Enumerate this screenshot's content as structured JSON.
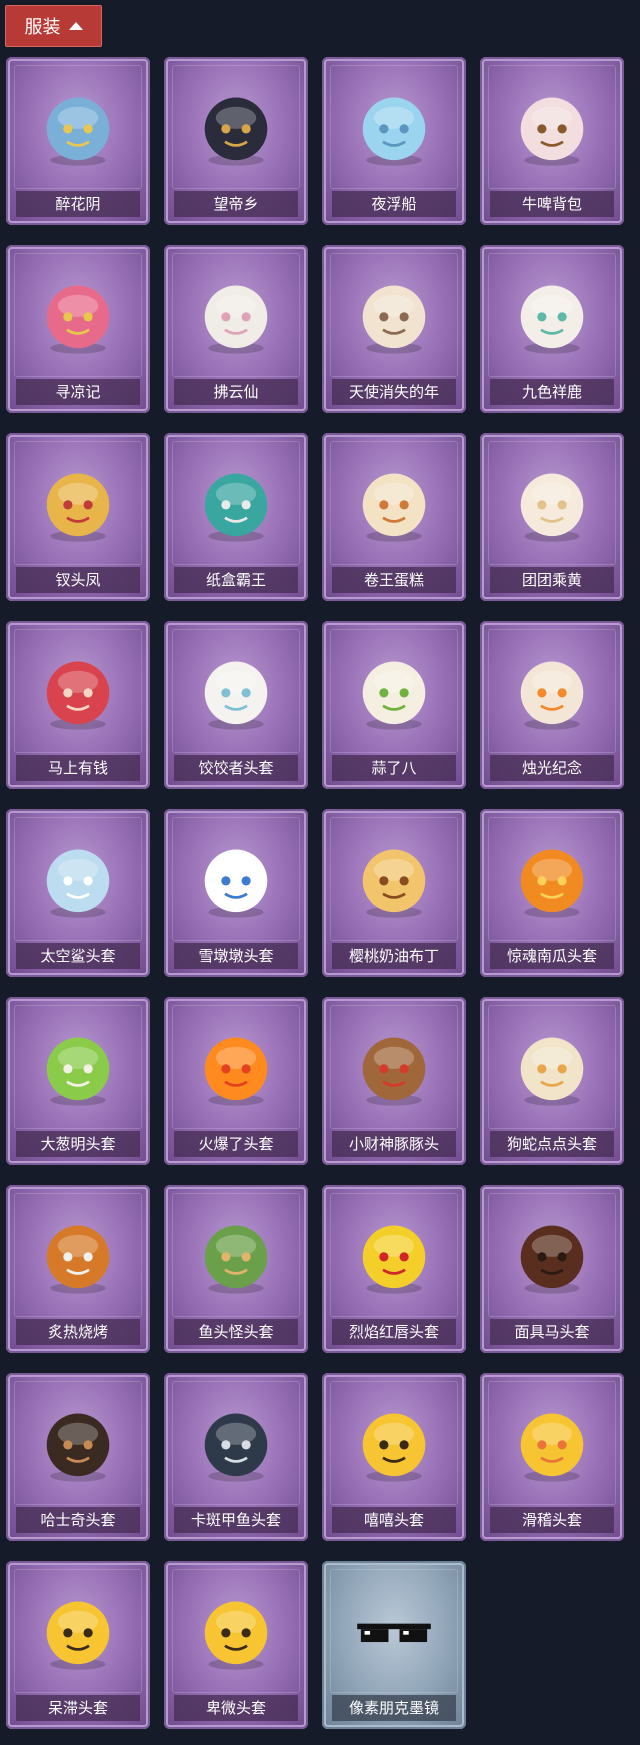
{
  "header": {
    "label": "服装"
  },
  "items": [
    {
      "name": "醉花阴",
      "icon": "floral-backpack-icon",
      "colors": [
        "#7ab0d8",
        "#e7c74f"
      ]
    },
    {
      "name": "望帝乡",
      "icon": "character-costume-icon",
      "colors": [
        "#2a2c3c",
        "#d7a64a"
      ]
    },
    {
      "name": "夜浮船",
      "icon": "jellyfish-backpack-icon",
      "colors": [
        "#9bd4ef",
        "#5a96c0"
      ]
    },
    {
      "name": "牛啤背包",
      "icon": "cow-barrel-backpack-icon",
      "colors": [
        "#f2dede",
        "#8b5a2b"
      ]
    },
    {
      "name": "寻凉记",
      "icon": "pink-hat-creature-icon",
      "colors": [
        "#e86a8a",
        "#e6c94a"
      ]
    },
    {
      "name": "拂云仙",
      "icon": "white-fox-charm-icon",
      "colors": [
        "#f0ece6",
        "#e0a2b6"
      ]
    },
    {
      "name": "天使消失的年",
      "icon": "angel-doll-charm-icon",
      "colors": [
        "#f1e3cf",
        "#8a6b52"
      ]
    },
    {
      "name": "九色祥鹿",
      "icon": "deer-charm-icon",
      "colors": [
        "#f3efe8",
        "#5fb8a8"
      ]
    },
    {
      "name": "钗头凤",
      "icon": "phoenix-crown-doll-icon",
      "colors": [
        "#e8b54a",
        "#c23b3b"
      ]
    },
    {
      "name": "纸盒霸王",
      "icon": "cardboard-dino-head-icon",
      "colors": [
        "#3aa6a0",
        "#e9e9e9"
      ]
    },
    {
      "name": "卷王蛋糕",
      "icon": "roll-cake-icon",
      "colors": [
        "#f3e2c4",
        "#d07a3a"
      ]
    },
    {
      "name": "团团乘黄",
      "icon": "round-cat-head-icon",
      "colors": [
        "#f5eadb",
        "#e3c18b"
      ]
    },
    {
      "name": "马上有钱",
      "icon": "red-horse-head-icon",
      "colors": [
        "#d9434d",
        "#f2d6c6"
      ]
    },
    {
      "name": "饺饺者头套",
      "icon": "dumpling-head-icon",
      "colors": [
        "#f4f3ef",
        "#7fc0d6"
      ]
    },
    {
      "name": "蒜了八",
      "icon": "garlic-head-icon",
      "colors": [
        "#f5efe1",
        "#6fb23e"
      ]
    },
    {
      "name": "烛光纪念",
      "icon": "candle-head-icon",
      "colors": [
        "#f3e6d6",
        "#f28a2d"
      ]
    },
    {
      "name": "太空鲨头套",
      "icon": "shark-head-icon",
      "colors": [
        "#bcdcef",
        "#ffffff"
      ]
    },
    {
      "name": "雪墩墩头套",
      "icon": "snowman-head-icon",
      "colors": [
        "#ffffff",
        "#3c7cd0"
      ]
    },
    {
      "name": "樱桃奶油布丁",
      "icon": "pudding-head-icon",
      "colors": [
        "#f2c46b",
        "#8a4a22"
      ]
    },
    {
      "name": "惊魂南瓜头套",
      "icon": "pumpkin-head-icon",
      "colors": [
        "#f18a21",
        "#ffd15a"
      ]
    },
    {
      "name": "大葱明头套",
      "icon": "green-onion-head-icon",
      "colors": [
        "#8acb4a",
        "#f4f1e4"
      ]
    },
    {
      "name": "火爆了头套",
      "icon": "fire-head-icon",
      "colors": [
        "#ff8a1e",
        "#e2401f"
      ]
    },
    {
      "name": "小财神豚豚头",
      "icon": "capybara-god-head-icon",
      "colors": [
        "#a0673a",
        "#d63a2a"
      ]
    },
    {
      "name": "狗蛇点点头套",
      "icon": "dog-snake-head-icon",
      "colors": [
        "#f1e4c8",
        "#e7a64a"
      ]
    },
    {
      "name": "炙热烧烤",
      "icon": "bbq-meat-head-icon",
      "colors": [
        "#d67a2a",
        "#f2f0ea"
      ]
    },
    {
      "name": "鱼头怪头套",
      "icon": "fish-head-mask-icon",
      "colors": [
        "#6aa04a",
        "#e3b46a"
      ]
    },
    {
      "name": "烈焰红唇头套",
      "icon": "yellow-mouse-head-icon",
      "colors": [
        "#f4cf2a",
        "#d0262a"
      ]
    },
    {
      "name": "面具马头套",
      "icon": "horse-mask-icon",
      "colors": [
        "#5a2e1e",
        "#2a1a14"
      ]
    },
    {
      "name": "哈士奇头套",
      "icon": "shiba-dog-head-icon",
      "colors": [
        "#3a2a22",
        "#c78a52"
      ]
    },
    {
      "name": "卡斑甲鱼头套",
      "icon": "seal-head-icon",
      "colors": [
        "#2e3a4a",
        "#d6dde4"
      ]
    },
    {
      "name": "嘻嘻头套",
      "icon": "grin-emoji-head-icon",
      "colors": [
        "#f6c531",
        "#3a2a18"
      ]
    },
    {
      "name": "滑稽头套",
      "icon": "smirk-emoji-head-icon",
      "colors": [
        "#f6c531",
        "#e8743a"
      ]
    },
    {
      "name": "呆滞头套",
      "icon": "blank-emoji-head-icon",
      "colors": [
        "#f6c531",
        "#3a2a18"
      ]
    },
    {
      "name": "卑微头套",
      "icon": "shy-emoji-head-icon",
      "colors": [
        "#f6c531",
        "#3a2a18"
      ]
    },
    {
      "name": "像素朋克墨镜",
      "icon": "pixel-sunglasses-icon",
      "colors": [
        "#111111",
        "#ffffff"
      ],
      "special": true
    }
  ]
}
